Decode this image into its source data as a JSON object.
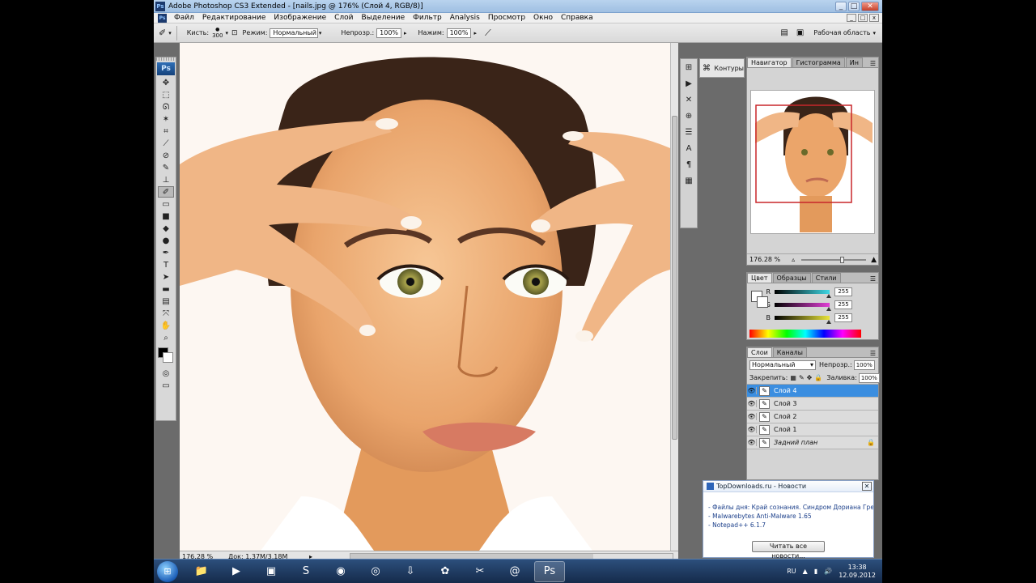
{
  "window": {
    "title": "Adobe Photoshop CS3 Extended - [nails.jpg @ 176% (Слой 4, RGB/8)]",
    "app_icon": "Ps",
    "minimize": "_",
    "maximize": "□",
    "close": "✕"
  },
  "menu": {
    "items": [
      "Файл",
      "Редактирование",
      "Изображение",
      "Слой",
      "Выделение",
      "Фильтр",
      "Analysis",
      "Просмотр",
      "Окно",
      "Справка"
    ],
    "doc_controls": [
      "_",
      "□",
      "x"
    ]
  },
  "options": {
    "brush_label": "Кисть:",
    "brush_size": "300",
    "mode_label": "Режим:",
    "mode_value": "Нормальный",
    "opacity_label": "Непрозр.:",
    "opacity_value": "100%",
    "pressure_label": "Нажим:",
    "pressure_value": "100%",
    "workspace_label": "Рабочая область"
  },
  "toolbox": {
    "logo": "Ps",
    "tools": [
      {
        "icon": "move-icon",
        "glyph": "✥"
      },
      {
        "icon": "marquee-icon",
        "glyph": "⬚"
      },
      {
        "icon": "lasso-icon",
        "glyph": "ᘏ"
      },
      {
        "icon": "magic-wand-icon",
        "glyph": "✶"
      },
      {
        "icon": "crop-icon",
        "glyph": "⌗"
      },
      {
        "icon": "slice-icon",
        "glyph": "⟋"
      },
      {
        "icon": "healing-icon",
        "glyph": "⊘"
      },
      {
        "icon": "brush-icon",
        "glyph": "✎"
      },
      {
        "icon": "stamp-icon",
        "glyph": "⊥"
      },
      {
        "icon": "history-brush-icon",
        "glyph": "✐"
      },
      {
        "icon": "eraser-icon",
        "glyph": "▭"
      },
      {
        "icon": "gradient-icon",
        "glyph": "■"
      },
      {
        "icon": "blur-icon",
        "glyph": "◆"
      },
      {
        "icon": "dodge-icon",
        "glyph": "●"
      },
      {
        "icon": "pen-icon",
        "glyph": "✒"
      },
      {
        "icon": "type-icon",
        "glyph": "T"
      },
      {
        "icon": "path-select-icon",
        "glyph": "➤"
      },
      {
        "icon": "shape-icon",
        "glyph": "▬"
      },
      {
        "icon": "notes-icon",
        "glyph": "▤"
      },
      {
        "icon": "eyedropper-icon",
        "glyph": "⤧"
      },
      {
        "icon": "hand-icon",
        "glyph": "✋"
      },
      {
        "icon": "zoom-icon",
        "glyph": "⌕"
      }
    ],
    "active_index": 9,
    "quickmask_icon": "◎",
    "screenmode_icon": "▭"
  },
  "document": {
    "zoom": "176.28 %",
    "doc_info": "Док: 1,37M/3,18M"
  },
  "side_strip": {
    "icons": [
      "⊞",
      "▶",
      "✕",
      "⊕",
      "☰",
      "A",
      "¶",
      "▦"
    ],
    "contours_label": "Контуры"
  },
  "navigator": {
    "tabs": [
      "Навигатор",
      "Гистограмма",
      "Ин"
    ],
    "zoom": "176.28 %"
  },
  "color_panel": {
    "tabs": [
      "Цвет",
      "Образцы",
      "Стили"
    ],
    "channels": [
      {
        "label": "R",
        "value": "255",
        "color": "#3fd7e4"
      },
      {
        "label": "G",
        "value": "255",
        "color": "#e23fd6"
      },
      {
        "label": "B",
        "value": "255",
        "color": "#e8e43a"
      }
    ]
  },
  "layers_panel": {
    "tabs": [
      "Слои",
      "Каналы"
    ],
    "blend_mode": "Нормальный",
    "opacity_label": "Непрозр.:",
    "opacity_value": "100%",
    "lock_label": "Закрепить:",
    "fill_label": "Заливка:",
    "fill_value": "100%",
    "layers": [
      {
        "name": "Слой 4",
        "selected": true
      },
      {
        "name": "Слой 3",
        "selected": false
      },
      {
        "name": "Слой 2",
        "selected": false
      },
      {
        "name": "Слой 1",
        "selected": false
      },
      {
        "name": "Задний план",
        "selected": false
      }
    ]
  },
  "notification": {
    "title": "TopDownloads.ru - Новости",
    "items": [
      "- Файлы дня: Край сознания. Синдром Дориана Грея...",
      "- Malwarebytes Anti-Malware 1.65",
      "- Notepad++ 6.1.7"
    ],
    "button": "Читать все новости..."
  },
  "taskbar": {
    "apps": [
      {
        "name": "explorer",
        "glyph": "📁"
      },
      {
        "name": "media-player",
        "glyph": "▶"
      },
      {
        "name": "window-app",
        "glyph": "▣"
      },
      {
        "name": "skype",
        "glyph": "S"
      },
      {
        "name": "firefox",
        "glyph": "◉"
      },
      {
        "name": "chrome",
        "glyph": "◎"
      },
      {
        "name": "download",
        "glyph": "⇩"
      },
      {
        "name": "game",
        "glyph": "✿"
      },
      {
        "name": "files",
        "glyph": "✂"
      },
      {
        "name": "mail",
        "glyph": "@"
      },
      {
        "name": "photoshop",
        "glyph": "Ps"
      }
    ],
    "language": "RU",
    "time": "13:38",
    "date": "12.09.2012"
  }
}
